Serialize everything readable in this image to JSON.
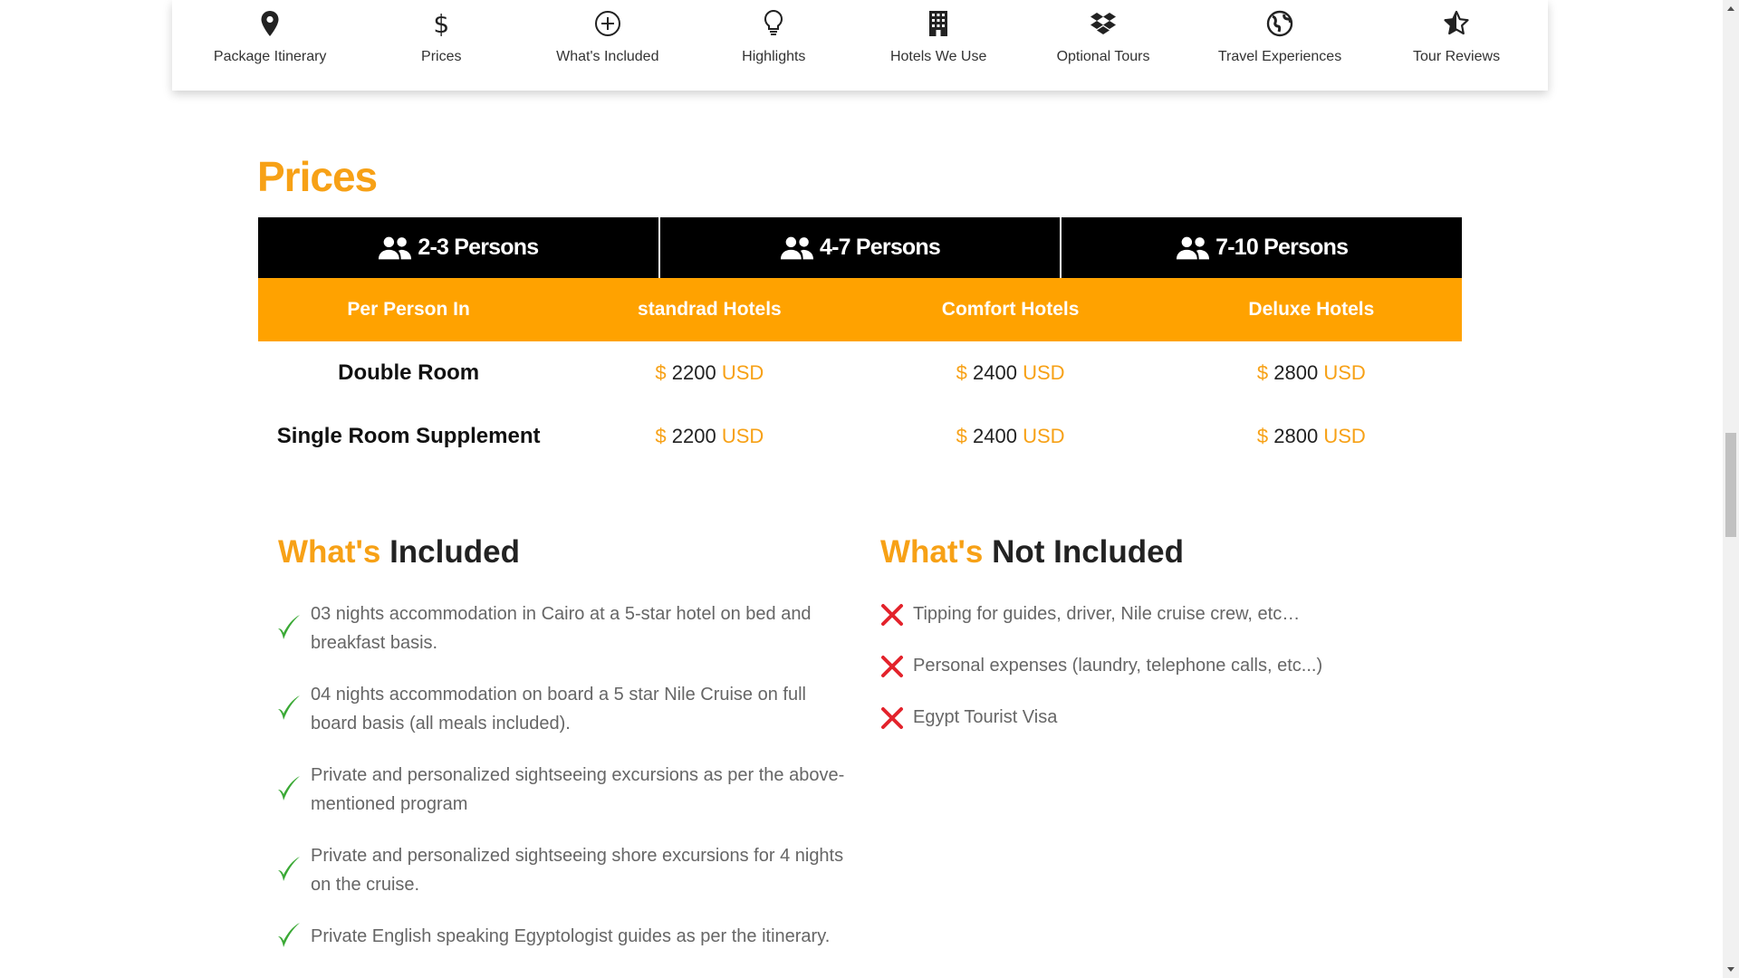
{
  "nav": {
    "items": [
      {
        "label": "Package Itinerary",
        "icon": "map-pin-icon"
      },
      {
        "label": "Prices",
        "icon": "dollar-icon"
      },
      {
        "label": "What's Included",
        "icon": "plus-circle-icon"
      },
      {
        "label": "Highlights",
        "icon": "lightbulb-icon"
      },
      {
        "label": "Hotels We Use",
        "icon": "building-icon"
      },
      {
        "label": "Optional Tours",
        "icon": "dropbox-icon"
      },
      {
        "label": "Travel Experiences",
        "icon": "globe-icon"
      },
      {
        "label": "Tour Reviews",
        "icon": "star-icon"
      }
    ]
  },
  "prices": {
    "title": "Prices",
    "groups": [
      "2-3 Persons",
      "4-7 Persons",
      "7-10 Persons"
    ],
    "columns": [
      "Per Person In",
      "standrad Hotels",
      "Comfort Hotels",
      "Deluxe Hotels"
    ],
    "currency_symbol": "$",
    "currency_code": "USD",
    "rows": [
      {
        "label": "Double Room",
        "values": [
          "2200",
          "2400",
          "2800"
        ]
      },
      {
        "label": "Single Room Supplement",
        "values": [
          "2200",
          "2400",
          "2800"
        ]
      }
    ]
  },
  "included": {
    "title_highlight": "What's",
    "title_rest": "Included",
    "items": [
      "03 nights accommodation in Cairo at a 5-star hotel on bed and breakfast basis.",
      "04 nights accommodation on board a 5 star Nile Cruise on full board basis (all meals included).",
      "Private and personalized sightseeing excursions as per the above-mentioned program",
      "Private and personalized sightseeing shore excursions for 4 nights on the cruise.",
      "Private English speaking Egyptologist guides as per the itinerary."
    ]
  },
  "not_included": {
    "title_highlight": "What's",
    "title_rest": "Not Included",
    "items": [
      "Tipping for guides, driver, Nile cruise crew, etc…",
      "Personal expenses (laundry, telephone calls, etc...)",
      "Egypt Tourist Visa"
    ]
  },
  "colors": {
    "accent": "#f7a116",
    "table_header": "#ffa200",
    "group_header": "#000000",
    "check": "#3aa935",
    "cross": "#e3232c"
  }
}
